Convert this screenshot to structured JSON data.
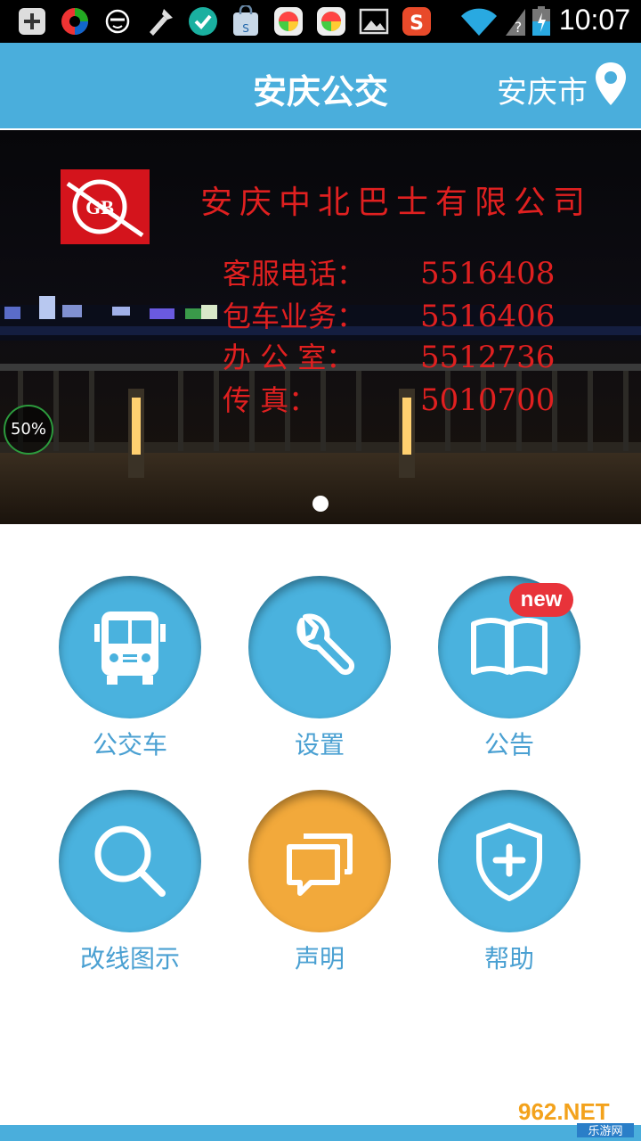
{
  "status_bar": {
    "time": "10:07",
    "icons": [
      "add-icon",
      "app-icon",
      "face-icon",
      "tool-icon",
      "check-icon",
      "bag-icon",
      "app-icon",
      "app-icon",
      "image-icon",
      "app-icon",
      "wifi-icon",
      "signal-icon",
      "battery-icon"
    ]
  },
  "header": {
    "title": "安庆公交",
    "city": "安庆市",
    "location_icon": "location-pin-icon"
  },
  "banner": {
    "company": "安庆中北巴士有限公司",
    "lines": [
      {
        "label": "客服电话：",
        "value": "5516408"
      },
      {
        "label": "包车业务：",
        "value": "5516406"
      },
      {
        "label": "办 公 室：",
        "value": "5512736"
      },
      {
        "label": "传     真：",
        "value": "5010700"
      }
    ],
    "logo_text": "GB",
    "load_percent": "50%"
  },
  "grid": {
    "items": [
      {
        "label": "公交车",
        "icon": "bus-icon",
        "color": "#4ab2de"
      },
      {
        "label": "设置",
        "icon": "wrench-icon",
        "color": "#4ab2de"
      },
      {
        "label": "公告",
        "icon": "book-icon",
        "color": "#4ab2de",
        "badge": "new"
      },
      {
        "label": "改线图示",
        "icon": "search-icon",
        "color": "#4ab2de"
      },
      {
        "label": "声明",
        "icon": "chat-icon",
        "color": "#f2a93b"
      },
      {
        "label": "帮助",
        "icon": "shield-plus-icon",
        "color": "#4ab2de"
      }
    ]
  },
  "watermark": {
    "text": "962.NET",
    "subtext": "乐游网"
  }
}
